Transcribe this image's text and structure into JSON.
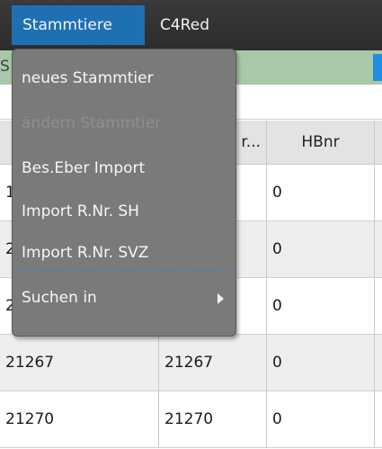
{
  "menubar": {
    "items": [
      {
        "label": "Stammtiere"
      },
      {
        "label": "C4Red"
      }
    ]
  },
  "toolbar": {
    "edge_text": "S"
  },
  "menu": {
    "items": [
      {
        "label": "neues Stammtier",
        "enabled": true
      },
      {
        "label": "ändern Stammtier",
        "enabled": false
      },
      {
        "label": "Bes.Eber Import",
        "enabled": true
      },
      {
        "label": "Import R.Nr. SH",
        "enabled": true
      },
      {
        "label": "Import R.Nr. SVZ",
        "enabled": true
      },
      {
        "label": "Suchen in",
        "enabled": true,
        "submenu": true
      }
    ]
  },
  "table": {
    "headers": [
      "",
      "r...",
      "HBnr"
    ],
    "rows": [
      [
        "1",
        "",
        "0"
      ],
      [
        "2",
        "",
        "0"
      ],
      [
        "2",
        "",
        "0"
      ],
      [
        "21267",
        "21267",
        "0"
      ],
      [
        "21270",
        "21270",
        "0"
      ]
    ]
  },
  "colors": {
    "menubar_bg": "#2c2c2c",
    "menu_active": "#1f6fb3",
    "dropdown_bg": "#7a7a7a",
    "toolbar_green": "#a9c8a8"
  }
}
